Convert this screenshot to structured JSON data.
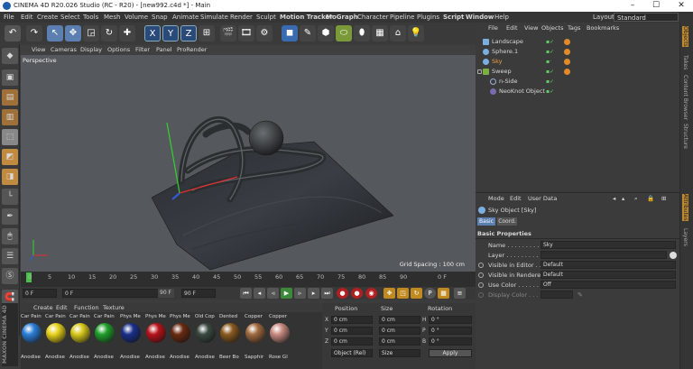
{
  "window": {
    "title": "CINEMA 4D R20.026 Studio (RC - R20) - [new992.c4d *] - Main"
  },
  "menubar": {
    "items": [
      "File",
      "Edit",
      "Create",
      "Select",
      "Tools",
      "Mesh",
      "Volume",
      "Snap",
      "Animate",
      "Simulate",
      "Render",
      "Sculpt",
      "Motion Tracker",
      "MoGraph",
      "Character",
      "Pipeline",
      "Plugins",
      "Script",
      "Window",
      "Help"
    ],
    "layout_label": "Layout:",
    "layout_value": "Standard"
  },
  "toolbar": {
    "axis_x": "X",
    "axis_y": "Y",
    "axis_z": "Z"
  },
  "viewport": {
    "menu": [
      "View",
      "Cameras",
      "Display",
      "Options",
      "Filter",
      "Panel",
      "ProRender"
    ],
    "label": "Perspective",
    "grid_spacing": "Grid Spacing : 100 cm"
  },
  "timeline": {
    "ticks": [
      "0",
      "5",
      "10",
      "15",
      "20",
      "25",
      "30",
      "35",
      "40",
      "45",
      "50",
      "55",
      "60",
      "65",
      "70",
      "75",
      "80",
      "85",
      "90"
    ],
    "end_label": "0 F"
  },
  "transport": {
    "current": "0 F",
    "start": "0 F",
    "end_preview": "90 F",
    "end": "90 F"
  },
  "material_panel": {
    "menu": [
      "Create",
      "Edit",
      "Function",
      "Texture"
    ],
    "materials": [
      {
        "name": "Car Pain",
        "label": "Anodise",
        "color": "#2a7fd8"
      },
      {
        "name": "Car Pain",
        "label": "Anodise",
        "color": "#e8d21a"
      },
      {
        "name": "Car Pain",
        "label": "Anodise",
        "color": "#d8c81a"
      },
      {
        "name": "Car Pain",
        "label": "Anodise",
        "color": "#1fa02a"
      },
      {
        "name": "Phys Me",
        "label": "Anodise",
        "color": "#1a2f8a"
      },
      {
        "name": "Phys Me",
        "label": "Anodise",
        "color": "#b8121a"
      },
      {
        "name": "Phys Me",
        "label": "Anodise",
        "color": "#6a2a10"
      },
      {
        "name": "Old Cop",
        "label": "Anodise",
        "color": "#3a4a40"
      },
      {
        "name": "Dented",
        "label": "Beer Bo",
        "color": "#8a5a20"
      },
      {
        "name": "Copper",
        "label": "Sapphir",
        "color": "#a06a40"
      },
      {
        "name": "Copper",
        "label": "Rose Gl",
        "color": "#c88a80"
      }
    ]
  },
  "coordinates": {
    "headers": {
      "position": "Position",
      "size": "Size",
      "rotation": "Rotation"
    },
    "rows": [
      {
        "axis": "X",
        "pos": "0 cm",
        "size": "0 cm",
        "rot_axis": "H",
        "rot": "0 °"
      },
      {
        "axis": "Y",
        "pos": "0 cm",
        "size": "0 cm",
        "rot_axis": "P",
        "rot": "0 °"
      },
      {
        "axis": "Z",
        "pos": "0 cm",
        "size": "0 cm",
        "rot_axis": "B",
        "rot": "0 °"
      }
    ],
    "mode": "Object (Rel)",
    "size_mode": "Size",
    "apply": "Apply"
  },
  "object_manager": {
    "menu": [
      "File",
      "Edit",
      "View",
      "Objects",
      "Tags",
      "Bookmarks"
    ],
    "objects": [
      {
        "name": "Landscape",
        "indent": 0,
        "color": "#7ab0e0",
        "tag": true
      },
      {
        "name": "Sphere.1",
        "indent": 0,
        "color": "#7ab0e0",
        "tag": true
      },
      {
        "name": "Sky",
        "indent": 0,
        "color": "#7ab0e0",
        "tag": true,
        "selected": true
      },
      {
        "name": "Sweep",
        "indent": 0,
        "color": "#7ab040",
        "tag": true
      },
      {
        "name": "n-Side",
        "indent": 1,
        "color": "#9ab0e0",
        "tag": false
      },
      {
        "name": "NeoKnot Object",
        "indent": 1,
        "color": "#9ab0e0",
        "tag": false
      }
    ]
  },
  "attributes": {
    "menu": [
      "Mode",
      "Edit",
      "User Data"
    ],
    "object_title": "Sky Object [Sky]",
    "tabs": [
      "Basic",
      "Coord."
    ],
    "section": "Basic Properties",
    "fields": [
      {
        "label": "Name . . . . . . . . . . . .",
        "value": "Sky"
      },
      {
        "label": "Layer . . . . . . . . . . . .",
        "value": ""
      },
      {
        "label": "Visible in Editor . .",
        "value": "Default"
      },
      {
        "label": "Visible in Renderer",
        "value": "Default"
      },
      {
        "label": "Use Color . . . . . . .",
        "value": "Off"
      },
      {
        "label": "Display Color . . . .",
        "value": ""
      }
    ]
  },
  "right_dock": {
    "tabs": [
      "Objects",
      "Takes",
      "Content Browser",
      "Structure",
      "Attributes",
      "Layers"
    ]
  },
  "side_label": "MAXON CINEMA 4D"
}
